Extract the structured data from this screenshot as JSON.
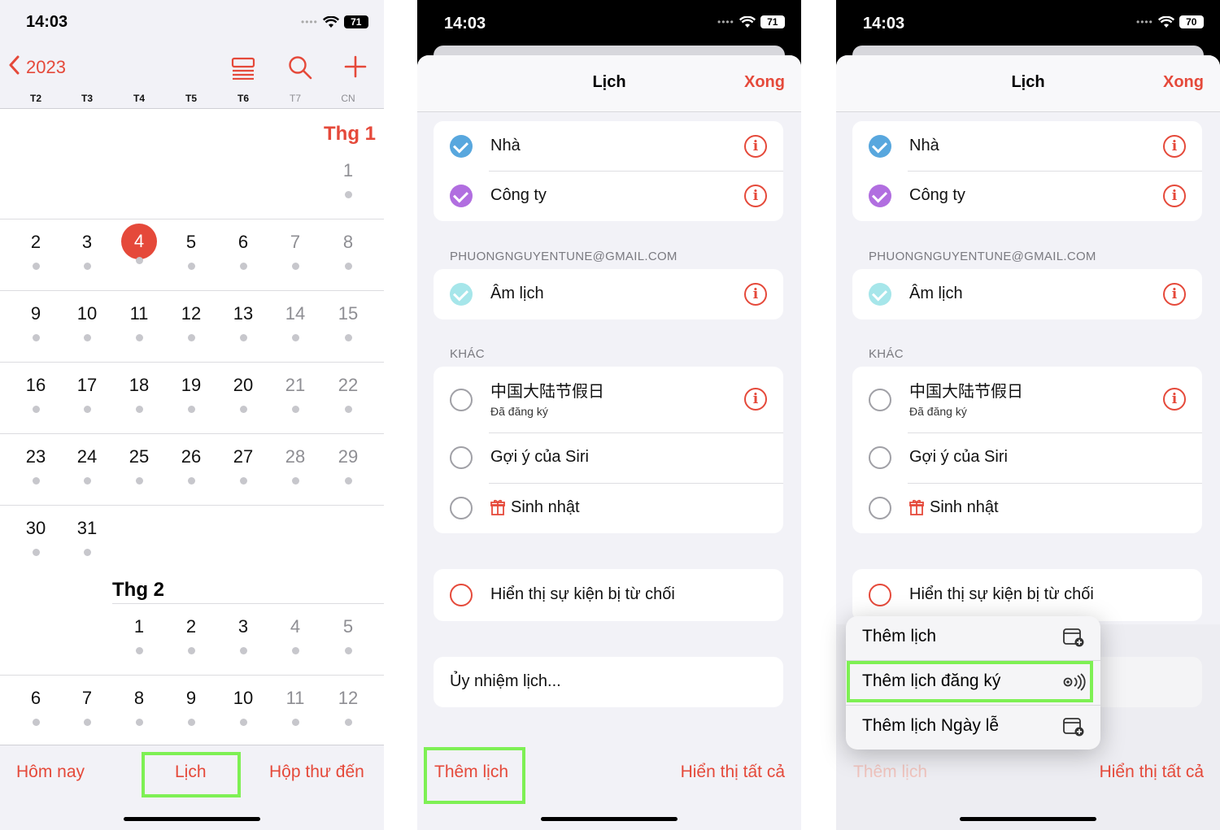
{
  "status": {
    "time": "14:03",
    "battery_p1": "71",
    "battery_p2": "71",
    "battery_p3": "70"
  },
  "calendar": {
    "year": "2023",
    "weekdays": [
      "T2",
      "T3",
      "T4",
      "T5",
      "T6",
      "T7",
      "CN"
    ],
    "month1": "Thg 1",
    "month2": "Thg 2",
    "today": "4",
    "jan_rows": [
      [
        "1"
      ],
      [
        "2",
        "3",
        "4",
        "5",
        "6",
        "7",
        "8"
      ],
      [
        "9",
        "10",
        "11",
        "12",
        "13",
        "14",
        "15"
      ],
      [
        "16",
        "17",
        "18",
        "19",
        "20",
        "21",
        "22"
      ],
      [
        "23",
        "24",
        "25",
        "26",
        "27",
        "28",
        "29"
      ],
      [
        "30",
        "31"
      ]
    ],
    "feb_rows": [
      [
        "1",
        "2",
        "3",
        "4",
        "5"
      ],
      [
        "6",
        "7",
        "8",
        "9",
        "10",
        "11",
        "12"
      ]
    ],
    "tabs": {
      "today": "Hôm nay",
      "calendars": "Lịch",
      "inbox": "Hộp thư đến"
    }
  },
  "sheet": {
    "title": "Lịch",
    "done": "Xong",
    "icloud_items": [
      "Nhà",
      "Công ty"
    ],
    "gmail_header": "PHUONGNGUYENTUNE@GMAIL.COM",
    "gmail_item": "Âm lịch",
    "other_header": "KHÁC",
    "other_items": [
      {
        "label": "中国大陆节假日",
        "sub": "Đã đăng ký"
      },
      {
        "label": "Gợi ý của Siri"
      },
      {
        "label": "Sinh nhật"
      }
    ],
    "show_declined": "Hiển thị sự kiện bị từ chối",
    "delegate": "Ủy nhiệm lịch...",
    "add_calendar": "Thêm lịch",
    "show_all": "Hiển thị tất cả"
  },
  "menu": {
    "items": [
      "Thêm lịch",
      "Thêm lịch đăng ký",
      "Thêm lịch Ngày lễ"
    ]
  },
  "colors": {
    "accent": "#e5493a",
    "home_check": "#58a7de",
    "work_check": "#b16ee0",
    "lunar_check": "#a6e6ea",
    "highlight": "#7ef054"
  }
}
